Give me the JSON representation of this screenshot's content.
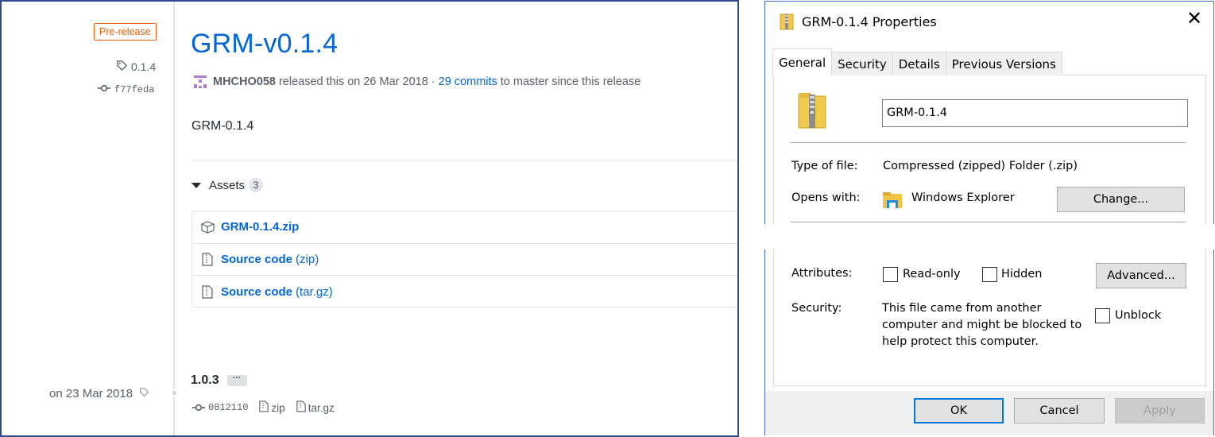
{
  "github": {
    "prerelease_badge": "Pre-release",
    "tag": "0.1.4",
    "commit": "f77feda",
    "title": "GRM-v0.1.4",
    "author": "MHCHO058",
    "released_text": "released this on 26 Mar 2018 ·",
    "commits_link": "29 commits",
    "since_text": "to master since this release",
    "body": "GRM-0.1.4",
    "assets_label": "Assets",
    "assets_count": "3",
    "assets": [
      {
        "name": "GRM-0.1.4.zip",
        "ext": "",
        "icon": "package-icon"
      },
      {
        "name": "Source code",
        "ext": "(zip)",
        "icon": "file-zip-icon"
      },
      {
        "name": "Source code",
        "ext": "(tar.gz)",
        "icon": "file-zip-icon"
      }
    ],
    "older": {
      "date": "on 23 Mar 2018",
      "title": "1.0.3",
      "ellipsis": "···",
      "commit": "0812110",
      "zip": "zip",
      "targz": "tar.gz"
    }
  },
  "dialog": {
    "title": "GRM-0.1.4 Properties",
    "close": "✕",
    "tabs": [
      "General",
      "Security",
      "Details",
      "Previous Versions"
    ],
    "active_tab": "General",
    "file_name": "GRM-0.1.4",
    "type_label": "Type of file:",
    "type_value": "Compressed (zipped) Folder (.zip)",
    "opens_label": "Opens with:",
    "opens_value": "Windows Explorer",
    "change_button": "Change...",
    "attributes_label": "Attributes:",
    "readonly_label": "Read-only",
    "hidden_label": "Hidden",
    "advanced_button": "Advanced...",
    "security_label": "Security:",
    "security_text_1": "This file came from another",
    "security_text_2": "computer and might be blocked to",
    "security_text_3": "help protect this computer.",
    "unblock_label": "Unblock",
    "ok_button": "OK",
    "cancel_button": "Cancel",
    "apply_button": "Apply",
    "readonly_checked": false,
    "hidden_checked": false,
    "unblock_checked": false
  },
  "colors": {
    "link": "#0366d6",
    "prerelease": "#e36209",
    "panel_border": "#2e4b8f",
    "dialog_border": "#3c6fb8",
    "default_button": "#0078d7"
  }
}
